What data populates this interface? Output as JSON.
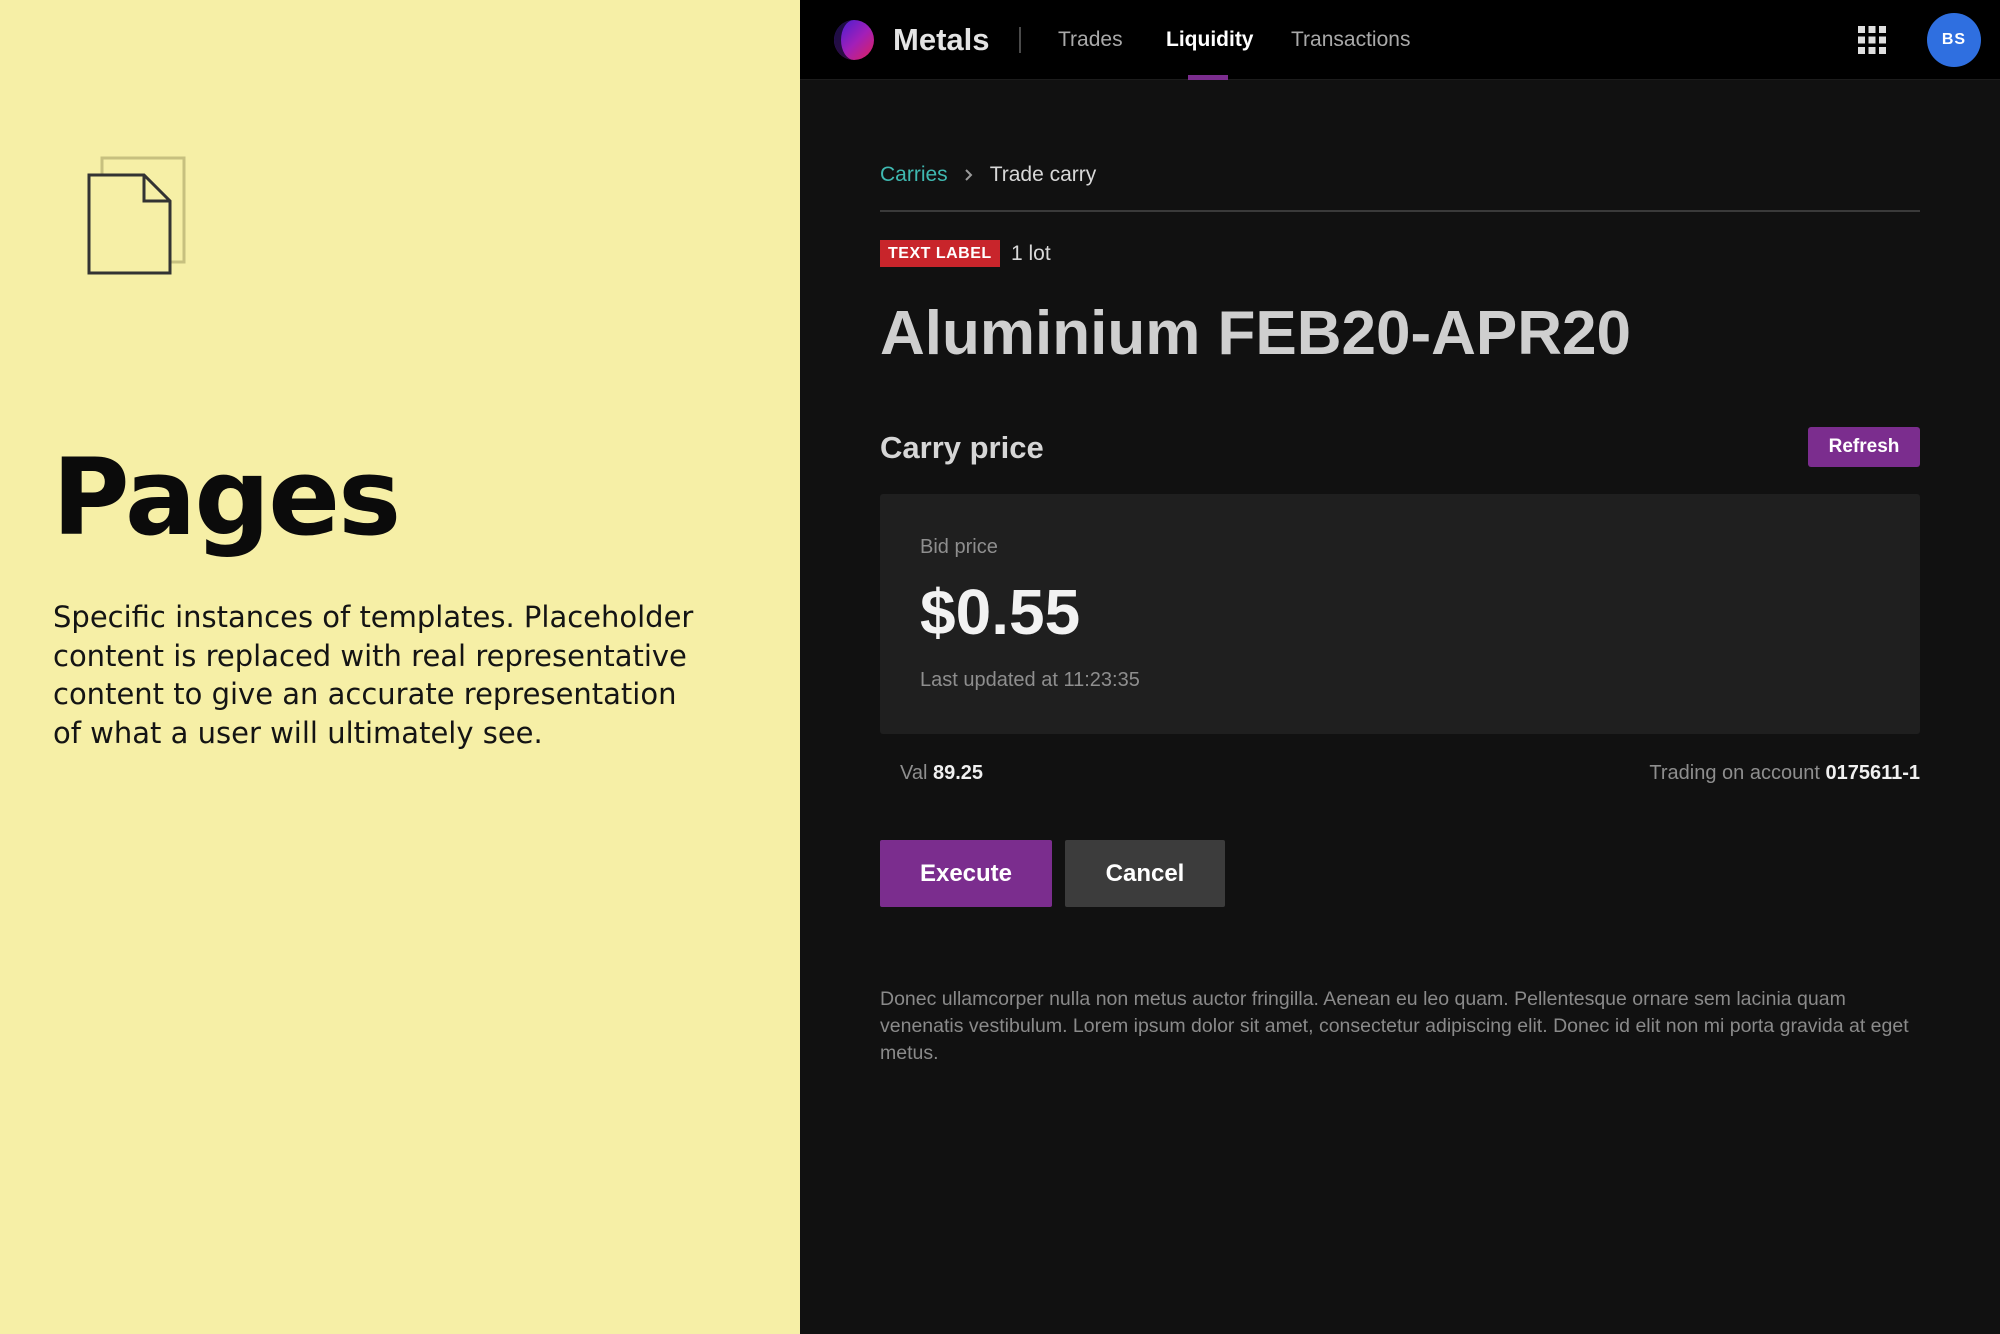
{
  "left_panel": {
    "icon": "document-stack-icon",
    "title": "Pages",
    "description": "Specific instances of templates. Placeholder content is replaced with real representative content to give an accurate representation of what a user will ultimately see."
  },
  "app": {
    "logo_icon": "metals-logo-icon",
    "name": "Metals",
    "nav": [
      {
        "label": "Trades",
        "active": false
      },
      {
        "label": "Liquidity",
        "active": true
      },
      {
        "label": "Transactions",
        "active": false
      }
    ],
    "apps_icon": "grid-icon",
    "avatar_initials": "BS"
  },
  "breadcrumb": {
    "parent": "Carries",
    "separator_icon": "chevron-right-icon",
    "current": "Trade carry"
  },
  "tag": "TEXT LABEL",
  "lot": "1 lot",
  "instrument": "Aluminium FEB20-APR20",
  "carry": {
    "section_title": "Carry price",
    "refresh_label": "Refresh",
    "bid_label": "Bid price",
    "bid_value": "$0.55",
    "last_updated": "Last updated at 11:23:35"
  },
  "val": {
    "label": "Val",
    "value": "89.25"
  },
  "account": {
    "label": "Trading on account",
    "value": "0175611-1"
  },
  "actions": {
    "execute_label": "Execute",
    "cancel_label": "Cancel"
  },
  "footnote": "Donec ullamcorper nulla non metus auctor fringilla. Aenean eu leo quam. Pellentesque ornare sem lacinia quam venenatis vestibulum. Lorem ipsum dolor sit amet, consectetur adipiscing elit. Donec id elit non mi porta gravida at eget metus.",
  "colors": {
    "left_background": "#f6efa6",
    "app_background": "#111111",
    "accent_purple": "#7b2d8e",
    "tag_red": "#c8252b",
    "link_teal": "#3fb9b1",
    "avatar_blue": "#2f6fe0"
  }
}
